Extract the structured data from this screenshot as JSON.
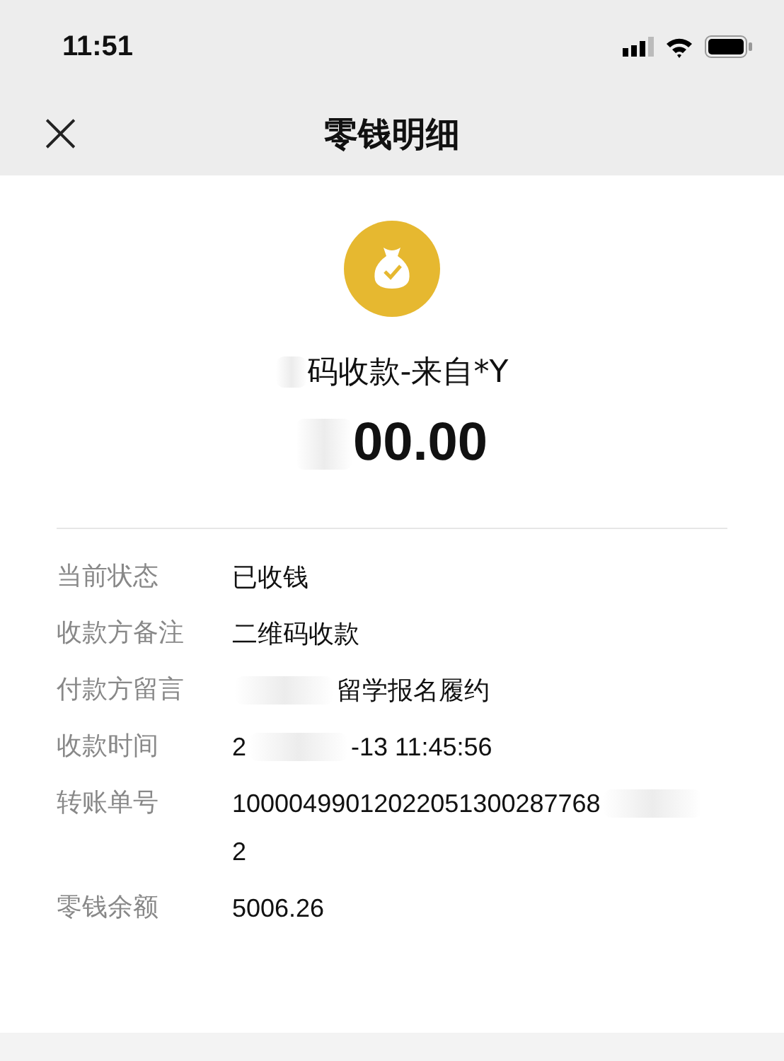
{
  "status_bar": {
    "time": "11:51"
  },
  "nav": {
    "close": "×",
    "title": "零钱明细"
  },
  "header": {
    "title_parts": [
      {
        "kind": "blur"
      },
      {
        "kind": "text",
        "text": "码收款-来自*Y"
      }
    ],
    "amount_parts": [
      {
        "kind": "blur"
      },
      {
        "kind": "text",
        "text": "00.00"
      }
    ]
  },
  "details": [
    {
      "label": "当前状态",
      "lines": [
        [
          {
            "kind": "text",
            "text": "已收钱"
          }
        ]
      ]
    },
    {
      "label": "收款方备注",
      "lines": [
        [
          {
            "kind": "text",
            "text": "二维码收款"
          }
        ]
      ]
    },
    {
      "label": "付款方留言",
      "lines": [
        [
          {
            "kind": "blur"
          },
          {
            "kind": "text",
            "text": "留学报名履约"
          }
        ]
      ]
    },
    {
      "label": "收款时间",
      "lines": [
        [
          {
            "kind": "text",
            "text": "2"
          },
          {
            "kind": "blur"
          },
          {
            "kind": "text",
            "text": "-13 11:45:56"
          }
        ]
      ]
    },
    {
      "label": "转账单号",
      "lines": [
        [
          {
            "kind": "text",
            "text": "10000499012022051300287768"
          },
          {
            "kind": "blur"
          }
        ],
        [
          {
            "kind": "text",
            "text": "2"
          }
        ]
      ]
    },
    {
      "label": "零钱余额",
      "lines": [
        [
          {
            "kind": "text",
            "text": "5006.26"
          }
        ]
      ]
    }
  ]
}
